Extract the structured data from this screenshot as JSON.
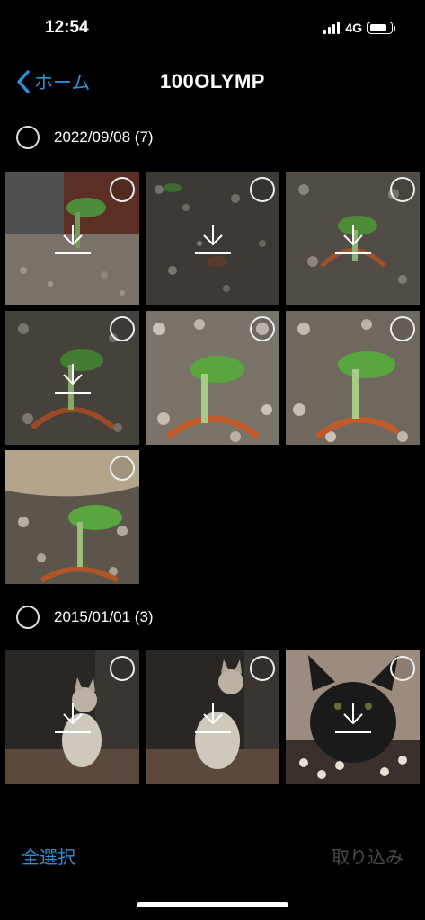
{
  "status": {
    "time": "12:54",
    "network": "4G"
  },
  "nav": {
    "back_label": "ホーム",
    "title": "100OLYMP"
  },
  "sections": [
    {
      "label": "2022/09/08 (7)"
    },
    {
      "label": "2015/01/01 (3)"
    }
  ],
  "toolbar": {
    "select_all_label": "全選択",
    "import_label": "取り込み"
  },
  "colors": {
    "accent": "#2d8fd6",
    "disabled": "#4a4a4a",
    "background": "#000000"
  },
  "icons": {
    "back": "chevron-left-icon",
    "download": "download-icon",
    "select": "circle-checkbox-icon"
  }
}
